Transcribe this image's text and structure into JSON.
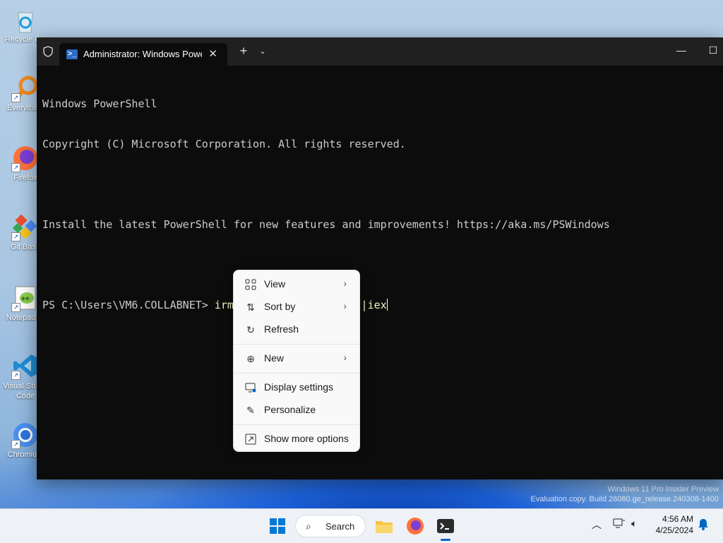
{
  "desktop": {
    "icons": [
      {
        "label": "Recycle Bin",
        "icon": "recycle-bin-icon"
      },
      {
        "label": "Everything",
        "icon": "everything-search-icon"
      },
      {
        "label": "Firefox",
        "icon": "firefox-icon"
      },
      {
        "label": "Git Bash",
        "icon": "git-bash-icon"
      },
      {
        "label": "Notepad++",
        "icon": "notepad-plus-plus-icon"
      },
      {
        "label": "Visual Studio Code",
        "icon": "vscode-icon"
      },
      {
        "label": "Chromium",
        "icon": "chromium-icon"
      }
    ],
    "watermark": {
      "line1": "Windows 11 Pro Insider Preview",
      "line2": "Evaluation copy. Build 26080.ge_release.240308-1400"
    }
  },
  "terminal": {
    "tab_title": "Administrator: Windows PowerShell",
    "new_tab_glyph": "+",
    "dropdown_glyph": "⌄",
    "close_tab_glyph": "✕",
    "minimize_glyph": "—",
    "maximize_glyph": "☐",
    "lines": [
      "Windows PowerShell",
      "Copyright (C) Microsoft Corporation. All rights reserved.",
      "",
      "Install the latest PowerShell for new features and improvements! https://aka.ms/PSWindows",
      ""
    ],
    "prompt": "PS C:\\Users\\VM6.COLLABNET> ",
    "command": "irm christitus.com/win |iex"
  },
  "context_menu": {
    "items": [
      {
        "label": "View",
        "icon": "view-grid-icon",
        "submenu": true
      },
      {
        "label": "Sort by",
        "icon": "sort-icon",
        "submenu": true
      },
      {
        "label": "Refresh",
        "icon": "refresh-icon",
        "submenu": false
      },
      {
        "label": "New",
        "icon": "new-plus-icon",
        "submenu": true
      },
      {
        "label": "Display settings",
        "icon": "display-settings-icon",
        "submenu": false
      },
      {
        "label": "Personalize",
        "icon": "personalize-brush-icon",
        "submenu": false
      },
      {
        "label": "Show more options",
        "icon": "show-more-options-icon",
        "submenu": false
      }
    ]
  },
  "taskbar": {
    "search_label": "Search",
    "time": "4:56 AM",
    "date": "4/25/2024",
    "accent": "#0067c0"
  }
}
